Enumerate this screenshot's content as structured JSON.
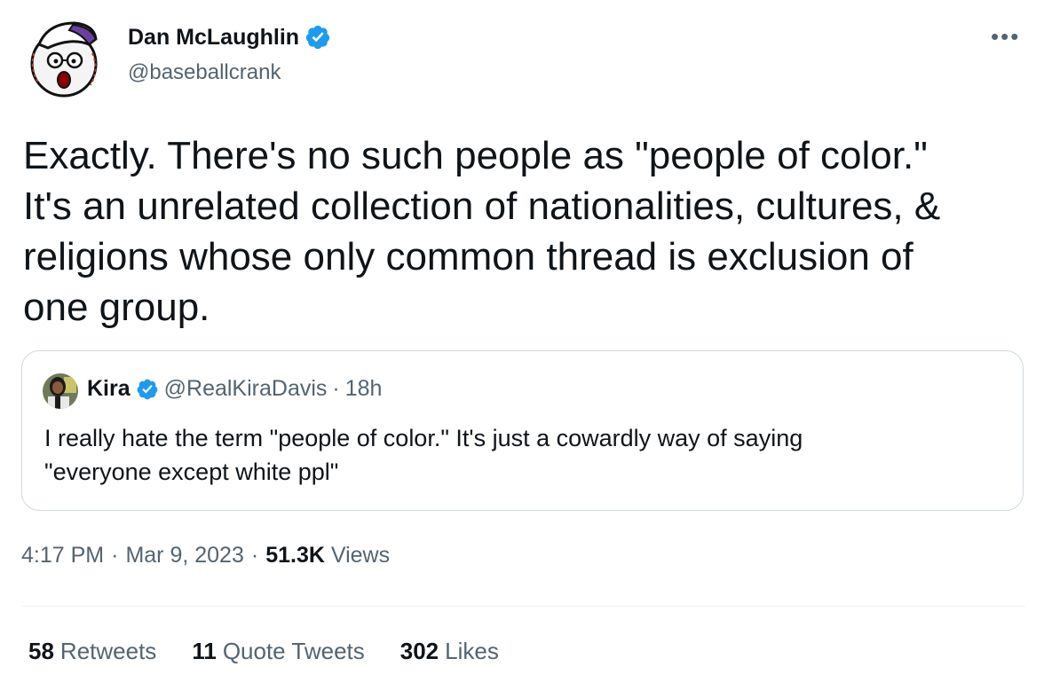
{
  "author": {
    "name": "Dan McLaughlin",
    "handle": "@baseballcrank",
    "verified_color": "#1d9bf0"
  },
  "tweet": {
    "text": "Exactly. There's no such people as \"people of color.\"\nIt's an unrelated collection of nationalities, cultures, &\nreligions whose only common thread is exclusion of\none group."
  },
  "quote": {
    "name": "Kira",
    "handle": "@RealKiraDavis",
    "separator": "·",
    "time": "18h",
    "text": "I really hate the term \"people of color.\" It's just a  cowardly way of saying\n\"everyone except white ppl\""
  },
  "meta": {
    "time": "4:17 PM",
    "sep1": "·",
    "date": "Mar 9, 2023",
    "sep2": "·",
    "views_count": "51.3K",
    "views_label": "Views"
  },
  "stats": {
    "retweets_count": "58",
    "retweets_label": "Retweets",
    "quotes_count": "11",
    "quotes_label": "Quote Tweets",
    "likes_count": "302",
    "likes_label": "Likes"
  },
  "icons": {
    "avatar": "baseball-cartoon-avatar",
    "verified": "verified-badge-icon",
    "more": "more-options-icon"
  }
}
